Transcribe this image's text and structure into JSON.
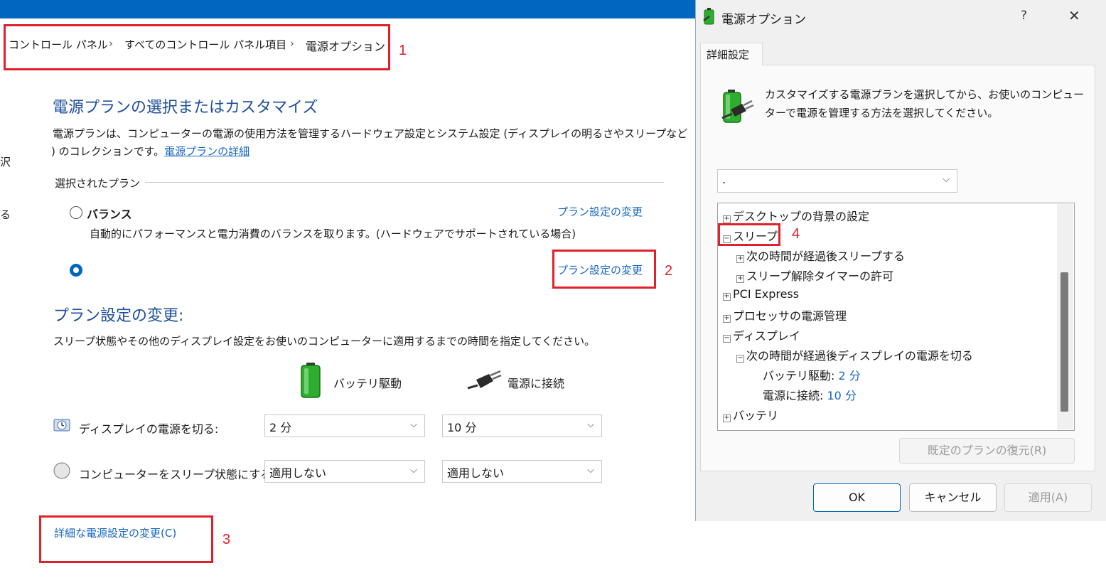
{
  "breadcrumb": {
    "items": [
      "コントロール パネル",
      "すべてのコントロール パネル項目",
      "電源オプション"
    ],
    "separator": "›"
  },
  "annotations": {
    "n1": "1",
    "n2": "2",
    "n3": "3",
    "n4": "4"
  },
  "left_edge": {
    "t1": "沢",
    "t2": "る"
  },
  "main": {
    "heading": "電源プランの選択またはカスタマイズ",
    "desc_line1": "電源プランは、コンピューターの電源の使用方法を管理するハードウェア設定とシステム設定 (ディスプレイの明るさやスリープなど",
    "desc_line2_prefix": ") のコレクションです。",
    "desc_link": "電源プランの詳細",
    "selected_plan_label": "選択されたプラン",
    "plans": [
      {
        "name": "バランス",
        "description": "自動的にパフォーマンスと電力消費のバランスを取ります。(ハードウェアでサポートされている場合)",
        "link": "プラン設定の変更",
        "selected": false
      },
      {
        "name": "",
        "description": "",
        "link": "プラン設定の変更",
        "selected": true
      }
    ],
    "change_heading": "プラン設定の変更:",
    "change_desc": "スリープ状態やその他のディスプレイ設定をお使いのコンピューターに適用するまでの時間を指定してください。",
    "col_battery": "バッテリ駆動",
    "col_plugged": "電源に接続",
    "rows": [
      {
        "label": "ディスプレイの電源を切る:",
        "battery": "2 分",
        "plugged": "10 分",
        "icon": "display-timer-icon"
      },
      {
        "label": "コンピューターをスリープ状態にする:",
        "battery": "適用しない",
        "plugged": "適用しない",
        "icon": "sleep-moon-icon"
      }
    ],
    "advanced_link": "詳細な電源設定の変更(C)"
  },
  "dialog": {
    "title": "電源オプション",
    "help": "?",
    "close": "✕",
    "tab": "詳細設定",
    "intro_line1": "カスタマイズする電源プランを選択してから、お使いのコンピュー",
    "intro_line2": "ターで電源を管理する方法を選択してください。",
    "plan_select_value": ".",
    "tree": [
      {
        "label": "デスクトップの背景の設定",
        "toggle": "+",
        "level": 0
      },
      {
        "label": "スリープ",
        "toggle": "−",
        "level": 0
      },
      {
        "label": "次の時間が経過後スリープする",
        "toggle": "+",
        "level": 1
      },
      {
        "label": "スリープ解除タイマーの許可",
        "toggle": "+",
        "level": 1
      },
      {
        "label": "PCI Express",
        "toggle": "+",
        "level": 0
      },
      {
        "label": "プロセッサの電源管理",
        "toggle": "+",
        "level": 0
      },
      {
        "label": "ディスプレイ",
        "toggle": "−",
        "level": 0
      },
      {
        "label": "次の時間が経過後ディスプレイの電源を切る",
        "toggle": "−",
        "level": 1
      },
      {
        "label": "バッテリ駆動:",
        "value": "2 分",
        "level": 2
      },
      {
        "label": "電源に接続:",
        "value": "10 分",
        "level": 2
      },
      {
        "label": "バッテリ",
        "toggle": "+",
        "level": 0
      }
    ],
    "restore_button": "既定のプランの復元(R)",
    "ok_button": "OK",
    "cancel_button": "キャンセル",
    "apply_button": "適用(A)"
  },
  "colors": {
    "accent": "#0067c0",
    "heading": "#1e4e9a",
    "link": "#1766c2",
    "annotation": "#e0202a"
  }
}
